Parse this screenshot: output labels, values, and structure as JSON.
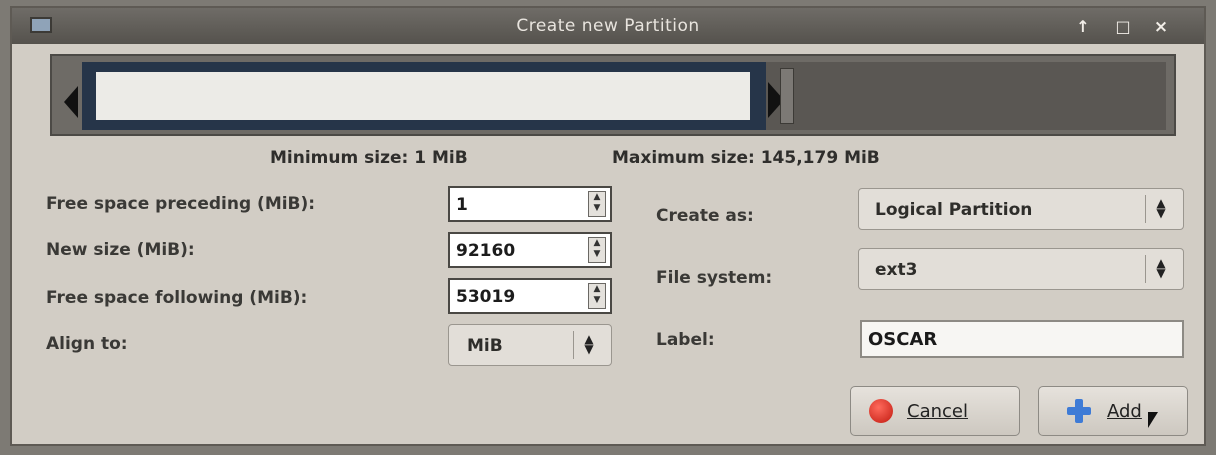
{
  "window": {
    "title": "Create new Partition",
    "controls": {
      "up": "↑",
      "maximize": "□",
      "close": "×"
    }
  },
  "sizes": {
    "minimum": "Minimum size: 1 MiB",
    "maximum": "Maximum size: 145,179 MiB"
  },
  "fields": {
    "free_preceding": {
      "label": "Free space preceding (MiB):",
      "value": "1"
    },
    "new_size": {
      "label": "New size (MiB):",
      "value": "92160"
    },
    "free_following": {
      "label": "Free space following (MiB):",
      "value": "53019"
    },
    "align_to": {
      "label": "Align to:",
      "value": "MiB"
    },
    "create_as": {
      "label": "Create as:",
      "value": "Logical Partition"
    },
    "file_system": {
      "label": "File system:",
      "value": "ext3"
    },
    "label": {
      "label": "Label:",
      "value": "OSCAR"
    }
  },
  "buttons": {
    "cancel": "Cancel",
    "add": "Add"
  },
  "icons": {
    "cancel": "stop-circle-icon",
    "add": "plus-icon",
    "app": "partition-app-icon"
  },
  "colors": {
    "partition_frame": "#263549",
    "cancel_icon": "#c11a10",
    "add_icon": "#3e7bd6"
  }
}
